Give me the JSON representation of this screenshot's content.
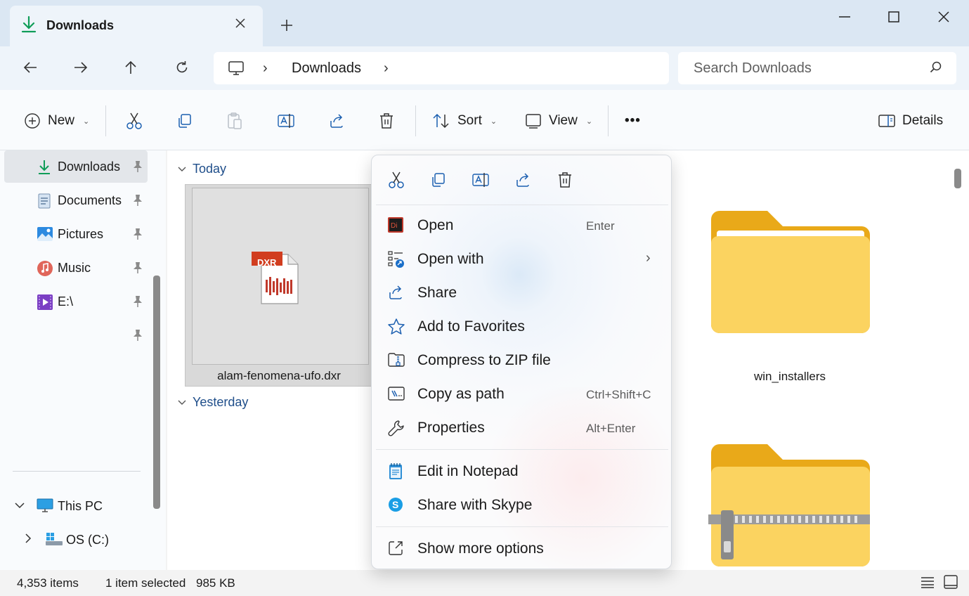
{
  "window": {
    "tab_title": "Downloads",
    "colors": {
      "accent": "#0f7b6c",
      "folder": "#f6c84a",
      "link": "#1f4e8a"
    }
  },
  "nav": {
    "breadcrumb": "Downloads",
    "search_placeholder": "Search Downloads"
  },
  "toolbar": {
    "new_label": "New",
    "sort_label": "Sort",
    "view_label": "View",
    "more_label": "•••",
    "details_label": "Details"
  },
  "sidebar": {
    "items": [
      {
        "label": "Downloads",
        "icon": "download-icon"
      },
      {
        "label": "Documents",
        "icon": "documents-icon"
      },
      {
        "label": "Pictures",
        "icon": "pictures-icon"
      },
      {
        "label": "Music",
        "icon": "music-icon"
      },
      {
        "label": "E:\\",
        "icon": "video-drive-icon"
      },
      {
        "label": "",
        "icon": "pin-icon"
      }
    ],
    "tree": [
      {
        "label": "This PC",
        "icon": "monitor-icon"
      },
      {
        "label": "OS (C:)",
        "icon": "drive-icon"
      }
    ]
  },
  "content": {
    "groups": [
      "Today",
      "Yesterday"
    ],
    "file_name": "alam-fenomena-ufo.dxr",
    "file_badge": "DXR",
    "folder_name": "win_installers"
  },
  "context_menu": {
    "items": [
      {
        "label": "Open",
        "key": "Enter",
        "icon": "director-icon"
      },
      {
        "label": "Open with",
        "key": "",
        "icon": "open-with-icon",
        "arrow": "›"
      },
      {
        "label": "Share",
        "key": "",
        "icon": "share-icon"
      },
      {
        "label": "Add to Favorites",
        "key": "",
        "icon": "star-icon"
      },
      {
        "label": "Compress to ZIP file",
        "key": "",
        "icon": "zip-icon"
      },
      {
        "label": "Copy as path",
        "key": "Ctrl+Shift+C",
        "icon": "copy-path-icon"
      },
      {
        "label": "Properties",
        "key": "Alt+Enter",
        "icon": "wrench-icon"
      },
      {
        "label": "Edit in Notepad",
        "key": "",
        "icon": "notepad-icon"
      },
      {
        "label": "Share with Skype",
        "key": "",
        "icon": "skype-icon"
      },
      {
        "label": "Show more options",
        "key": "",
        "icon": "more-options-icon"
      }
    ]
  },
  "status": {
    "count": "4,353 items",
    "selected": "1 item selected",
    "size": "985 KB"
  }
}
